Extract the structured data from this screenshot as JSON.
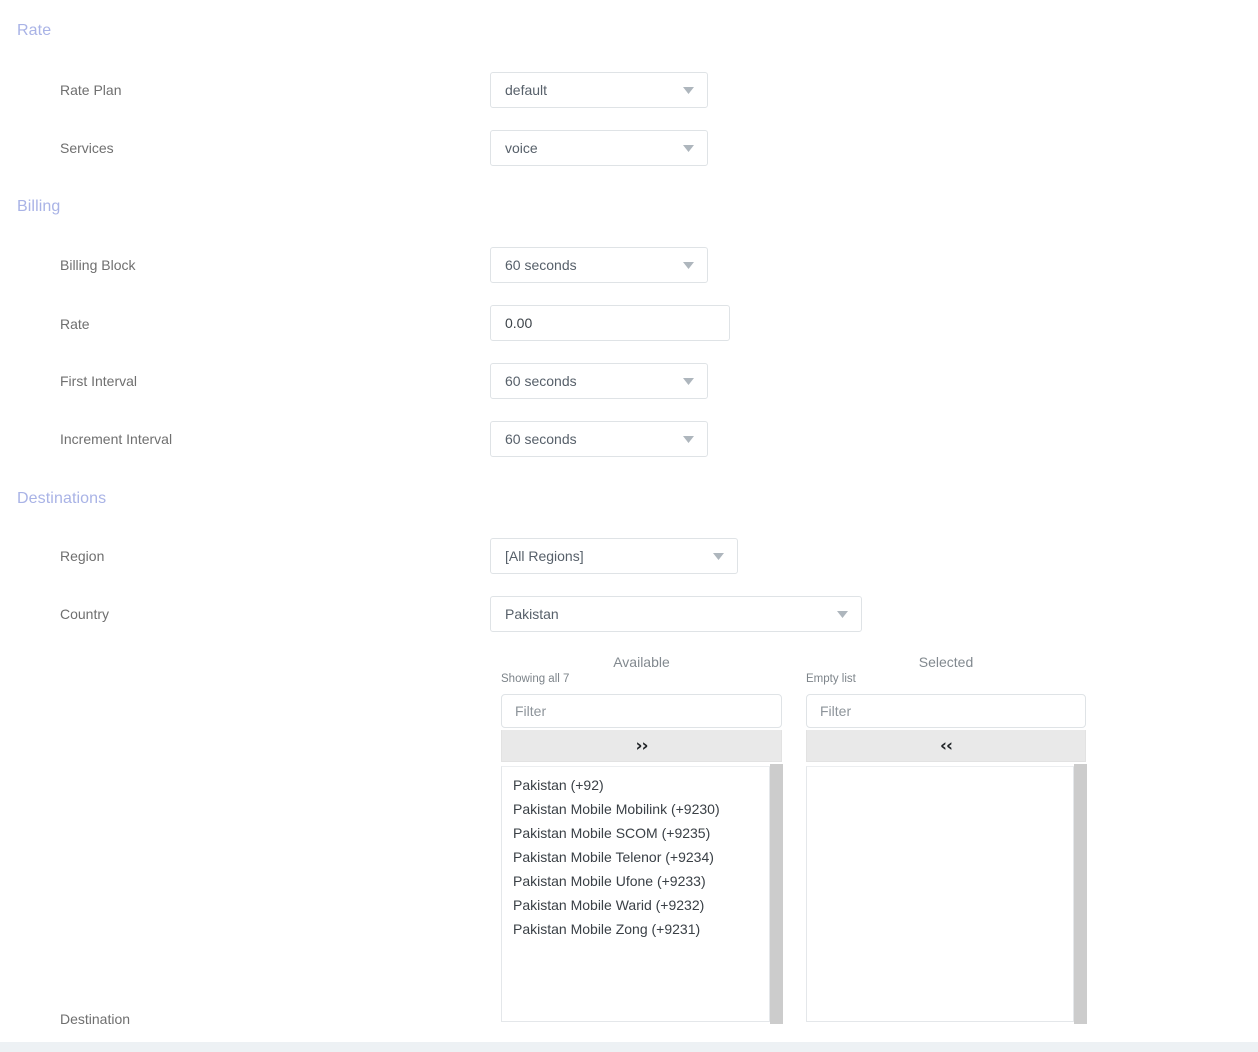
{
  "sections": {
    "rate": "Rate",
    "billing": "Billing",
    "destinations": "Destinations"
  },
  "fields": {
    "rate_plan": {
      "label": "Rate Plan",
      "value": "default",
      "type": "select"
    },
    "services": {
      "label": "Services",
      "value": "voice",
      "type": "select"
    },
    "billing_block": {
      "label": "Billing Block",
      "value": "60 seconds",
      "type": "select"
    },
    "rate": {
      "label": "Rate",
      "value": "0.00",
      "type": "input"
    },
    "first_interval": {
      "label": "First Interval",
      "value": "60 seconds",
      "type": "select"
    },
    "increment_interval": {
      "label": "Increment Interval",
      "value": "60 seconds",
      "type": "select"
    },
    "region": {
      "label": "Region",
      "value": "[All Regions]",
      "type": "select"
    },
    "country": {
      "label": "Country",
      "value": "Pakistan",
      "type": "select"
    },
    "destination": {
      "label": "Destination"
    }
  },
  "dual_list": {
    "available": {
      "title": "Available",
      "subtitle": "Showing all 7",
      "filter_placeholder": "Filter",
      "filter_value": "",
      "transfer_label": "››",
      "items": [
        "Pakistan (+92)",
        "Pakistan Mobile Mobilink (+9230)",
        "Pakistan Mobile SCOM (+9235)",
        "Pakistan Mobile Telenor (+9234)",
        "Pakistan Mobile Ufone (+9233)",
        "Pakistan Mobile Warid (+9232)",
        "Pakistan Mobile Zong (+9231)"
      ]
    },
    "selected": {
      "title": "Selected",
      "subtitle": "Empty list",
      "filter_placeholder": "Filter",
      "filter_value": "",
      "transfer_label": "‹‹",
      "items": []
    }
  },
  "colors": {
    "section_header": "#a9b3e6",
    "label": "#6f6f6f",
    "value": "#57606a",
    "border": "#dfe3e6",
    "transfer_bar": "#e9e9e9",
    "scrollbar": "#cccccc",
    "footer_band": "#edf1f4"
  },
  "icons": {
    "caret": "chevron-down-icon",
    "transfer_right": "double-chevron-right-icon",
    "transfer_left": "double-chevron-left-icon"
  }
}
